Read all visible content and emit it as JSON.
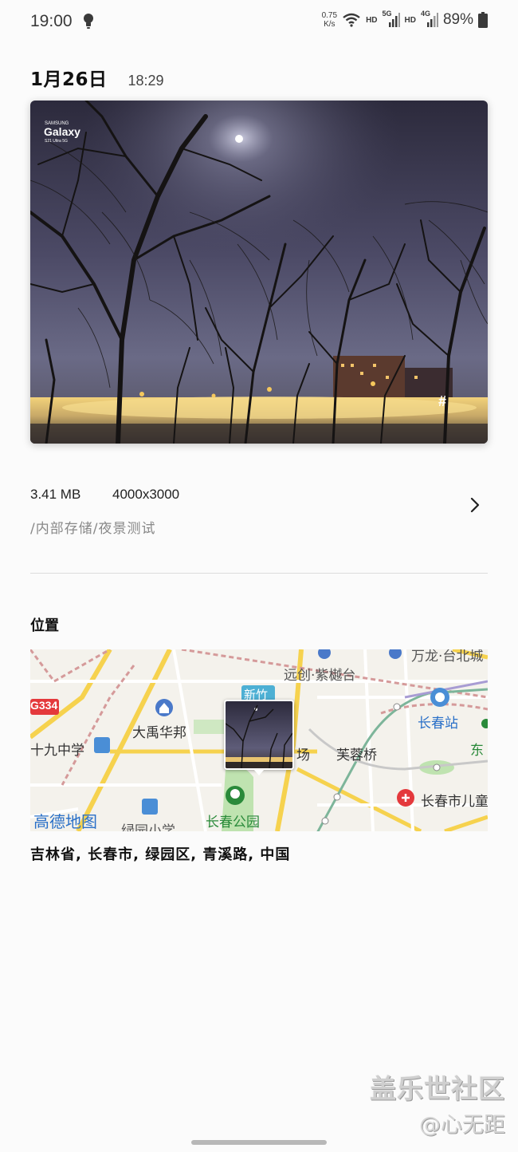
{
  "status_bar": {
    "time": "19:00",
    "net_speed": "0.75",
    "net_speed_unit": "K/s",
    "hd1": "HD",
    "net1": "5G",
    "hd2": "HD",
    "net2": "4G",
    "battery": "89%"
  },
  "header": {
    "date": "1月26日",
    "time": "18:29"
  },
  "photo": {
    "watermark_brand": "SAMSUNG",
    "watermark_model": "Galaxy",
    "watermark_sub": "S21 Ultra 5G",
    "corner_symbol": "#"
  },
  "details": {
    "file_size": "3.41 MB",
    "resolution": "4000x3000",
    "path": "/内部存储/夜景测试"
  },
  "location": {
    "title": "位置",
    "address": "吉林省, 长春市, 绿园区, 青溪路, 中国",
    "map_labels": {
      "yuanchuang": "远创·紫樾台",
      "wanlong": "万龙·台北城",
      "g334": "G334",
      "xinzhu": "新竹",
      "changchun_station": "长春站",
      "dayu": "大禹华邦",
      "shijiu": "十九中学",
      "chang": "场",
      "furong": "芙蓉桥",
      "dong": "东",
      "amap": "高德地图",
      "lvyuan": "绿园小学",
      "changchun_park": "长春公园",
      "children": "长春市儿童"
    },
    "map_colors": {
      "road_major": "#f6d24e",
      "road_minor": "#ffffff",
      "rail": "#d59a9a",
      "green": "#bfe3b0",
      "water": "#a9d3f2"
    }
  },
  "watermark": {
    "line1": "盖乐世社区",
    "line2": "@心无距"
  }
}
